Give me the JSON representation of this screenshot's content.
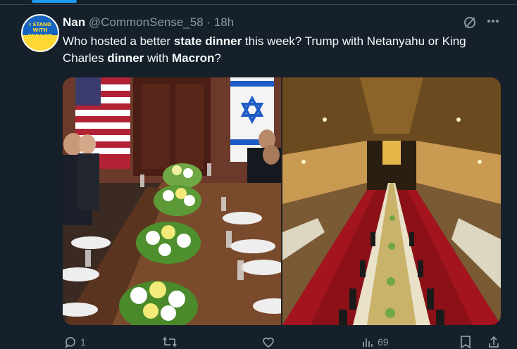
{
  "tweet": {
    "author_name": "Nan",
    "handle": "@CommonSense_58",
    "time": "· 18h",
    "text_parts": [
      {
        "t": "Who hosted a better ",
        "b": false
      },
      {
        "t": "state dinner",
        "b": true
      },
      {
        "t": " this week? Trump with Netanyahu or King Charles ",
        "b": false
      },
      {
        "t": "dinner",
        "b": true
      },
      {
        "t": " with ",
        "b": false
      },
      {
        "t": "Macron",
        "b": true
      },
      {
        "t": "?",
        "b": false
      }
    ]
  },
  "avatar": {
    "badge_text": "I STAND WITH UKRAINE"
  },
  "actions": {
    "replies": "1",
    "views": "69"
  },
  "colors": {
    "background": "#15202b",
    "accent": "#1d9bf0",
    "secondary_text": "#8b98a5"
  }
}
